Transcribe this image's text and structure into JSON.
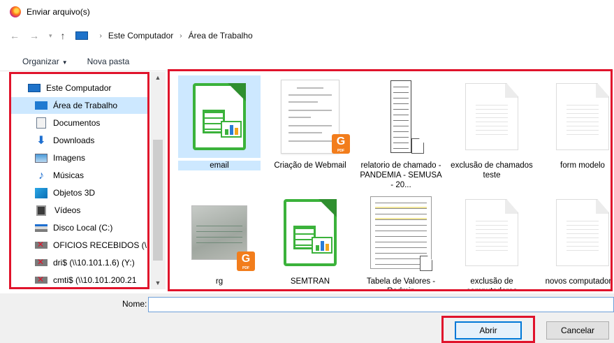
{
  "window": {
    "title": "Enviar arquivo(s)"
  },
  "address": {
    "crumbs": [
      "Este Computador",
      "Área de Trabalho"
    ]
  },
  "toolbar": {
    "organize_label": "Organizar",
    "new_folder_label": "Nova pasta"
  },
  "sidebar": {
    "items": [
      {
        "label": "Este Computador",
        "icon": "computer-icon"
      },
      {
        "label": "Área de Trabalho",
        "icon": "desktop-icon",
        "selected": true
      },
      {
        "label": "Documentos",
        "icon": "documents-icon"
      },
      {
        "label": "Downloads",
        "icon": "download-icon"
      },
      {
        "label": "Imagens",
        "icon": "pictures-icon"
      },
      {
        "label": "Músicas",
        "icon": "music-icon"
      },
      {
        "label": "Objetos 3D",
        "icon": "3d-objects-icon"
      },
      {
        "label": "Vídeos",
        "icon": "video-icon"
      },
      {
        "label": "Disco Local (C:)",
        "icon": "local-disk-icon"
      },
      {
        "label": "OFICIOS RECEBIDOS (\\",
        "icon": "network-drive-disconnected-icon"
      },
      {
        "label": "dri$ (\\\\10.101.1.6) (Y:)",
        "icon": "network-drive-disconnected-icon"
      },
      {
        "label": "cmti$ (\\\\10.101.200.21",
        "icon": "network-drive-disconnected-icon"
      }
    ]
  },
  "files": [
    {
      "name": "email",
      "type": "spreadsheet",
      "selected": true
    },
    {
      "name": "Criação de Webmail",
      "type": "pdf-document"
    },
    {
      "name": "relatorio de chamado - PANDEMIA - SEMUSA - 20...",
      "type": "long-document"
    },
    {
      "name": "exclusão de chamados teste",
      "type": "blank-document"
    },
    {
      "name": "form modelo",
      "type": "blank-document"
    },
    {
      "name": "rg",
      "type": "pdf-photo"
    },
    {
      "name": "SEMTRAN",
      "type": "spreadsheet"
    },
    {
      "name": "Tabela de Valores - Radmin",
      "type": "table-document"
    },
    {
      "name": "exclusão de computadores",
      "type": "blank-document"
    },
    {
      "name": "novos computadores",
      "type": "blank-document"
    }
  ],
  "footer": {
    "name_label": "Nome:",
    "name_value": "",
    "open_label": "Abrir",
    "cancel_label": "Cancelar"
  },
  "colors": {
    "highlight_border": "#e0132b",
    "selection": "#cde8ff",
    "calc_green": "#3bb23b",
    "pdf_orange": "#f27d1c"
  }
}
